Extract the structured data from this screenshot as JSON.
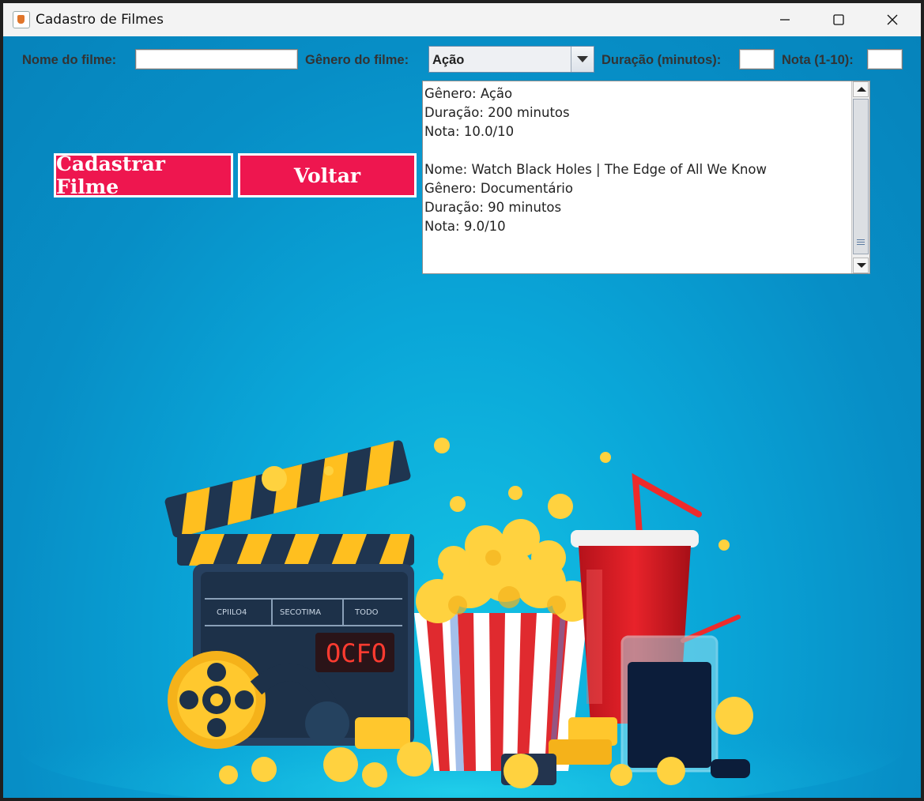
{
  "window": {
    "title": "Cadastro de Filmes"
  },
  "form": {
    "nome_label": "Nome do filme:",
    "nome_value": "",
    "genero_label": "Gênero do filme:",
    "genero_selected": "Ação",
    "duracao_label": "Duração (minutos):",
    "duracao_value": "",
    "nota_label": "Nota (1-10):",
    "nota_value": ""
  },
  "buttons": {
    "cadastrar": "Cadastrar Filme",
    "voltar": "Voltar"
  },
  "output": {
    "text": "Gênero: Ação\nDuração: 200 minutos\nNota: 10.0/10\n\nNome: Watch Black Holes | The Edge of All We Know\nGênero: Documentário\nDuração: 90 minutos\nNota: 9.0/10"
  },
  "illustration": {
    "clapper_screen_text": "OCFO",
    "clapper_labels": [
      "CPIILO4",
      "SECOTIMA",
      "TODO"
    ]
  },
  "colors": {
    "background": "#0a8dc7",
    "button": "#ee164f",
    "button_border": "#ffffff"
  }
}
